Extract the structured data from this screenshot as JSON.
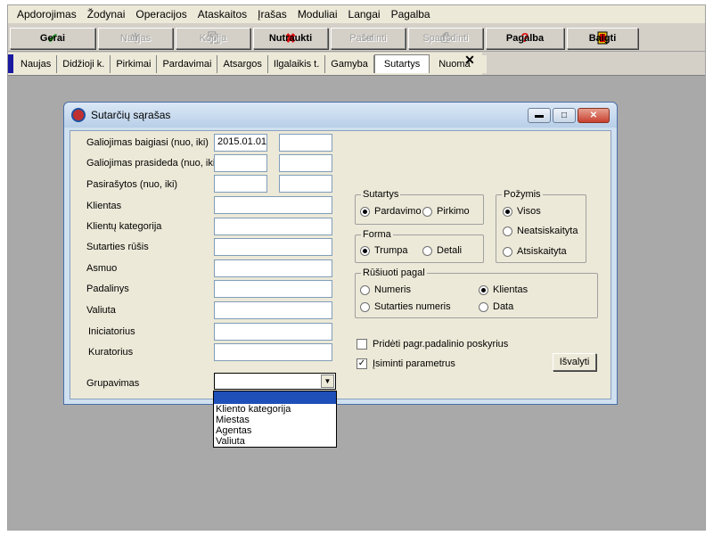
{
  "menu": [
    "Apdorojimas",
    "Žodynai",
    "Operacijos",
    "Ataskaitos",
    "Įrašas",
    "Moduliai",
    "Langai",
    "Pagalba"
  ],
  "toolbar": {
    "ok": "Gerai",
    "new": "Naujas",
    "copy": "Kopija",
    "cancel": "Nutraukti",
    "delete": "Pašalinti",
    "print": "Spausdinti",
    "help": "Pagalba",
    "exit": "Baigti"
  },
  "tabs": [
    "Naujas",
    "Didžioji k.",
    "Pirkimai",
    "Pardavimai",
    "Atsargos",
    "Ilgalaikis t.",
    "Gamyba",
    "Sutartys",
    "Nuoma"
  ],
  "tab_close": "✕",
  "window": {
    "title": "Sutarčių sąrašas",
    "minimize": "▬",
    "maximize": "□",
    "close": "✕"
  },
  "form": {
    "valid_until_label": "Galiojimas baigiasi (nuo, iki)",
    "valid_until_from": "2015.01.01",
    "valid_until_to": "",
    "valid_from_label": "Galiojimas prasideda (nuo, iki)",
    "signed_label": "Pasirašytos (nuo, iki)",
    "client_label": "Klientas",
    "client_category_label": "Klientų kategorija",
    "contract_type_label": "Sutarties rūšis",
    "person_label": "Asmuo",
    "department_label": "Padalinys",
    "currency_label": "Valiuta",
    "initiator_label": "Iniciatorius",
    "curator_label": "Kuratorius",
    "grouping_label": "Grupavimas",
    "grouping_value": "",
    "grouping_options": [
      "",
      "Kliento kategorija",
      "Miestas",
      "Agentas",
      "Valiuta"
    ]
  },
  "contracts_group": {
    "title": "Sutartys",
    "options": [
      "Pardavimo",
      "Pirkimo"
    ],
    "selected": 0
  },
  "form_group": {
    "title": "Forma",
    "options": [
      "Trumpa",
      "Detali"
    ],
    "selected": 0
  },
  "feature_group": {
    "title": "Požymis",
    "options": [
      "Visos",
      "Neatsiskaityta",
      "Atsiskaityta"
    ],
    "selected": 0
  },
  "sort_group": {
    "title": "Rūšiuoti pagal",
    "options": [
      "Numeris",
      "Klientas",
      "Sutarties numeris",
      "Data"
    ],
    "selected": 1
  },
  "checks": {
    "add_subdivisions": "Pridėti  pagr.padalinio poskyrius",
    "add_subdivisions_checked": false,
    "remember": "Įsiminti parametrus",
    "remember_checked": true
  },
  "clear_button": "Išvalyti",
  "colors": {
    "workspace": "#a9a9a9",
    "selection": "#1f4fb8",
    "window_frame": "#cfe0f0"
  }
}
